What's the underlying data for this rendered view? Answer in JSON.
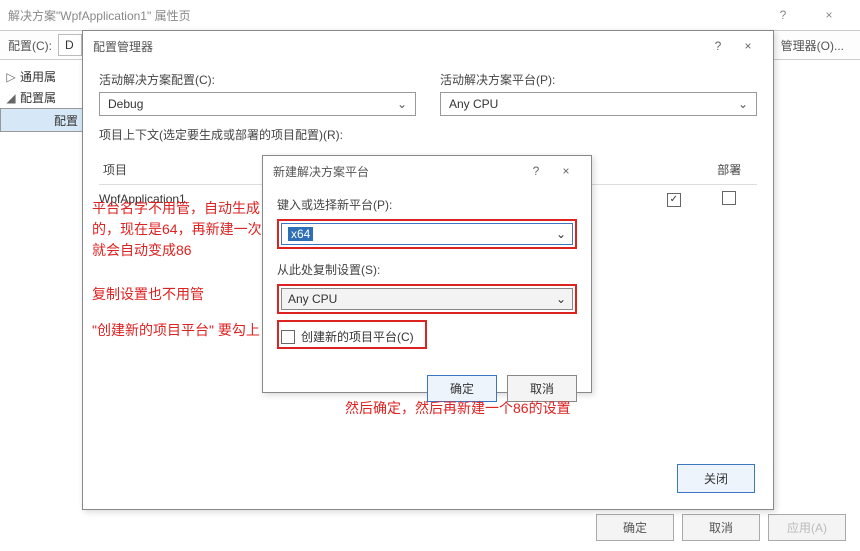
{
  "window": {
    "title": "解决方案\"WpfApplication1\" 属性页",
    "help": "?",
    "close": "×"
  },
  "ribbon": {
    "config_lbl": "配置(C):",
    "config_val": "D",
    "mgr": "管理器(O)..."
  },
  "tree": {
    "n1": "通用属",
    "n2": "配置属",
    "n3": "配置"
  },
  "buttons": {
    "ok": "确定",
    "cancel": "取消",
    "apply": "应用(A)"
  },
  "dlg1": {
    "title": "配置管理器",
    "sol_cfg_lbl": "活动解决方案配置(C):",
    "sol_cfg_val": "Debug",
    "sol_plat_lbl": "活动解决方案平台(P):",
    "sol_plat_val": "Any CPU",
    "ctx_lbl": "项目上下文(选定要生成或部署的项目配置)(R):",
    "hdr_project": "项目",
    "hdr_deploy": "部署",
    "row_project": "WpfApplication1",
    "row_build_chk": "✓",
    "close": "关闭"
  },
  "dlg2": {
    "title": "新建解决方案平台",
    "new_plat_lbl": "键入或选择新平台(P):",
    "new_plat_val": "x64",
    "copy_lbl": "从此处复制设置(S):",
    "copy_val": "Any CPU",
    "create_lbl": "创建新的项目平台(C)",
    "ok": "确定",
    "cancel": "取消"
  },
  "anno": {
    "a1": "平台名字不用管，自动生成的，现在是64，再新建一次就会自动变成86",
    "a2": "复制设置也不用管",
    "a3": "\"创建新的项目平台\" 要勾上",
    "a4": "然后确定，然后再新建一个86的设置"
  }
}
